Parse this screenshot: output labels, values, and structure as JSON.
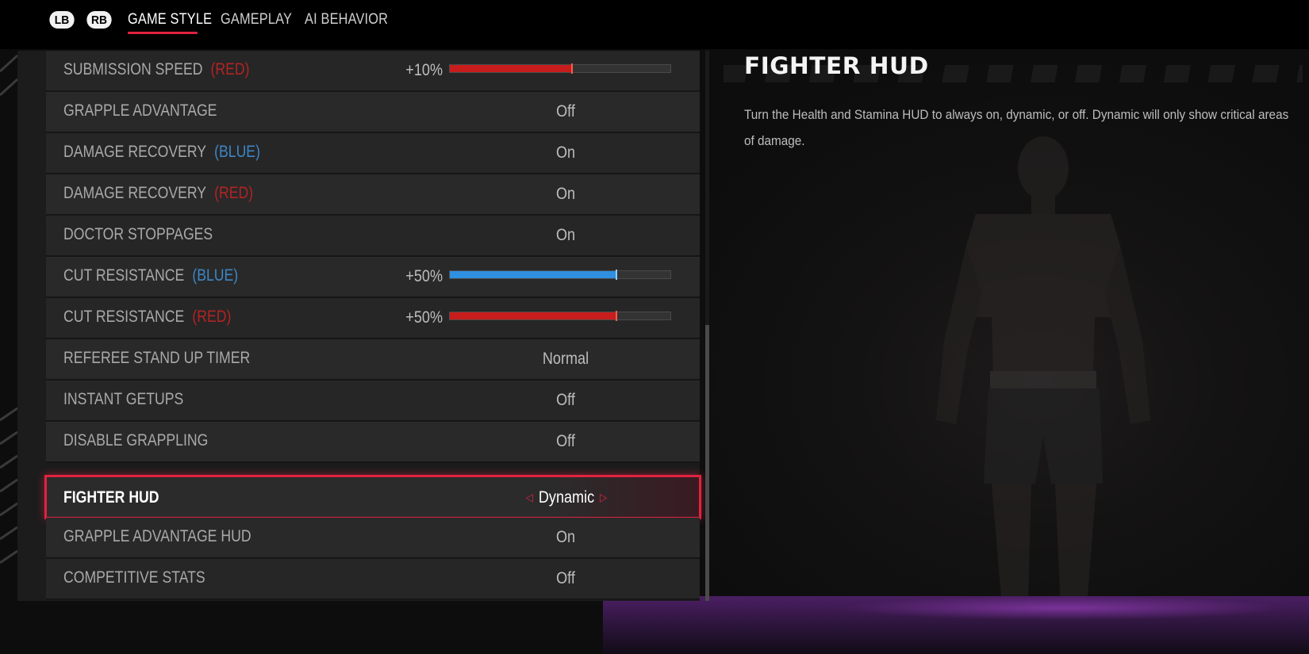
{
  "nav": {
    "left_bumper": "LB",
    "right_bumper": "RB",
    "tabs": [
      "GAME STYLE",
      "GAMEPLAY",
      "AI BEHAVIOR"
    ],
    "active_tab": "GAME STYLE"
  },
  "settings": [
    {
      "label": "SUBMISSION SPEED",
      "tag": "(RED)",
      "tag_color": "#b32323",
      "percent": "+10%",
      "bar_color": "#c81d1d",
      "bar_level": 0.55
    },
    {
      "label": "GRAPPLE ADVANTAGE",
      "value": "Off"
    },
    {
      "label": "DAMAGE RECOVERY",
      "tag": "(BLUE)",
      "tag_color": "#3d86c6",
      "value": "On"
    },
    {
      "label": "DAMAGE RECOVERY",
      "tag": "(RED)",
      "tag_color": "#b32323",
      "value": "On"
    },
    {
      "label": "DOCTOR STOPPAGES",
      "value": "On"
    },
    {
      "label": "CUT RESISTANCE",
      "tag": "(BLUE)",
      "tag_color": "#3d86c6",
      "percent": "+50%",
      "bar_color": "#2f8fe0",
      "bar_level": 0.75
    },
    {
      "label": "CUT RESISTANCE",
      "tag": "(RED)",
      "tag_color": "#b32323",
      "percent": "+50%",
      "bar_color": "#c81d1d",
      "bar_level": 0.75
    },
    {
      "label": "REFEREE STAND UP TIMER",
      "value": "Normal"
    },
    {
      "label": "INSTANT GETUPS",
      "value": "Off"
    },
    {
      "label": "DISABLE GRAPPLING",
      "value": "Off"
    },
    {
      "label": "FIGHTER HUD",
      "value": "Dynamic",
      "selected": true
    },
    {
      "label": "GRAPPLE ADVANTAGE HUD",
      "value": "On"
    },
    {
      "label": "COMPETITIVE STATS",
      "value": "Off"
    }
  ],
  "detail": {
    "title": "FIGHTER HUD",
    "description": "Turn the Health and Stamina HUD to always on, dynamic, or off. Dynamic will only show critical areas of damage."
  },
  "colors": {
    "accent": "#e0233f",
    "red_team": "#c81d1d",
    "blue_team": "#2f8fe0",
    "floor_glow": "#4b1f63"
  },
  "icons": {
    "prev_option": "left-triangle-icon",
    "next_option": "right-triangle-icon"
  }
}
